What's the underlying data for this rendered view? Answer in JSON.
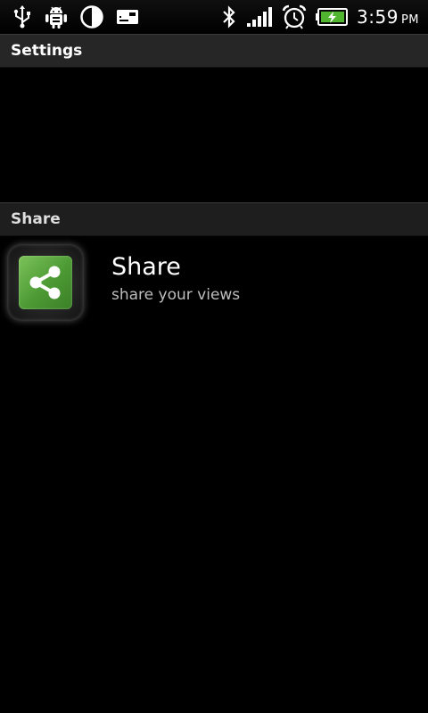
{
  "status_bar": {
    "time": "3:59",
    "ampm": "PM",
    "left_icons": [
      "usb-icon",
      "android-debug-icon",
      "brightness-icon",
      "sd-card-icon"
    ],
    "right_icons": [
      "bluetooth-icon",
      "signal-icon",
      "alarm-icon",
      "battery-charging-icon"
    ]
  },
  "sections": [
    {
      "title": "Settings"
    },
    {
      "title": "Share"
    }
  ],
  "share_item": {
    "title": "Share",
    "subtitle": "share your views",
    "icon": "share-icon"
  },
  "colors": {
    "background": "#000000",
    "header": "#262626",
    "icon_green": "#5aa83c",
    "subtitle": "#bdbdbd"
  }
}
